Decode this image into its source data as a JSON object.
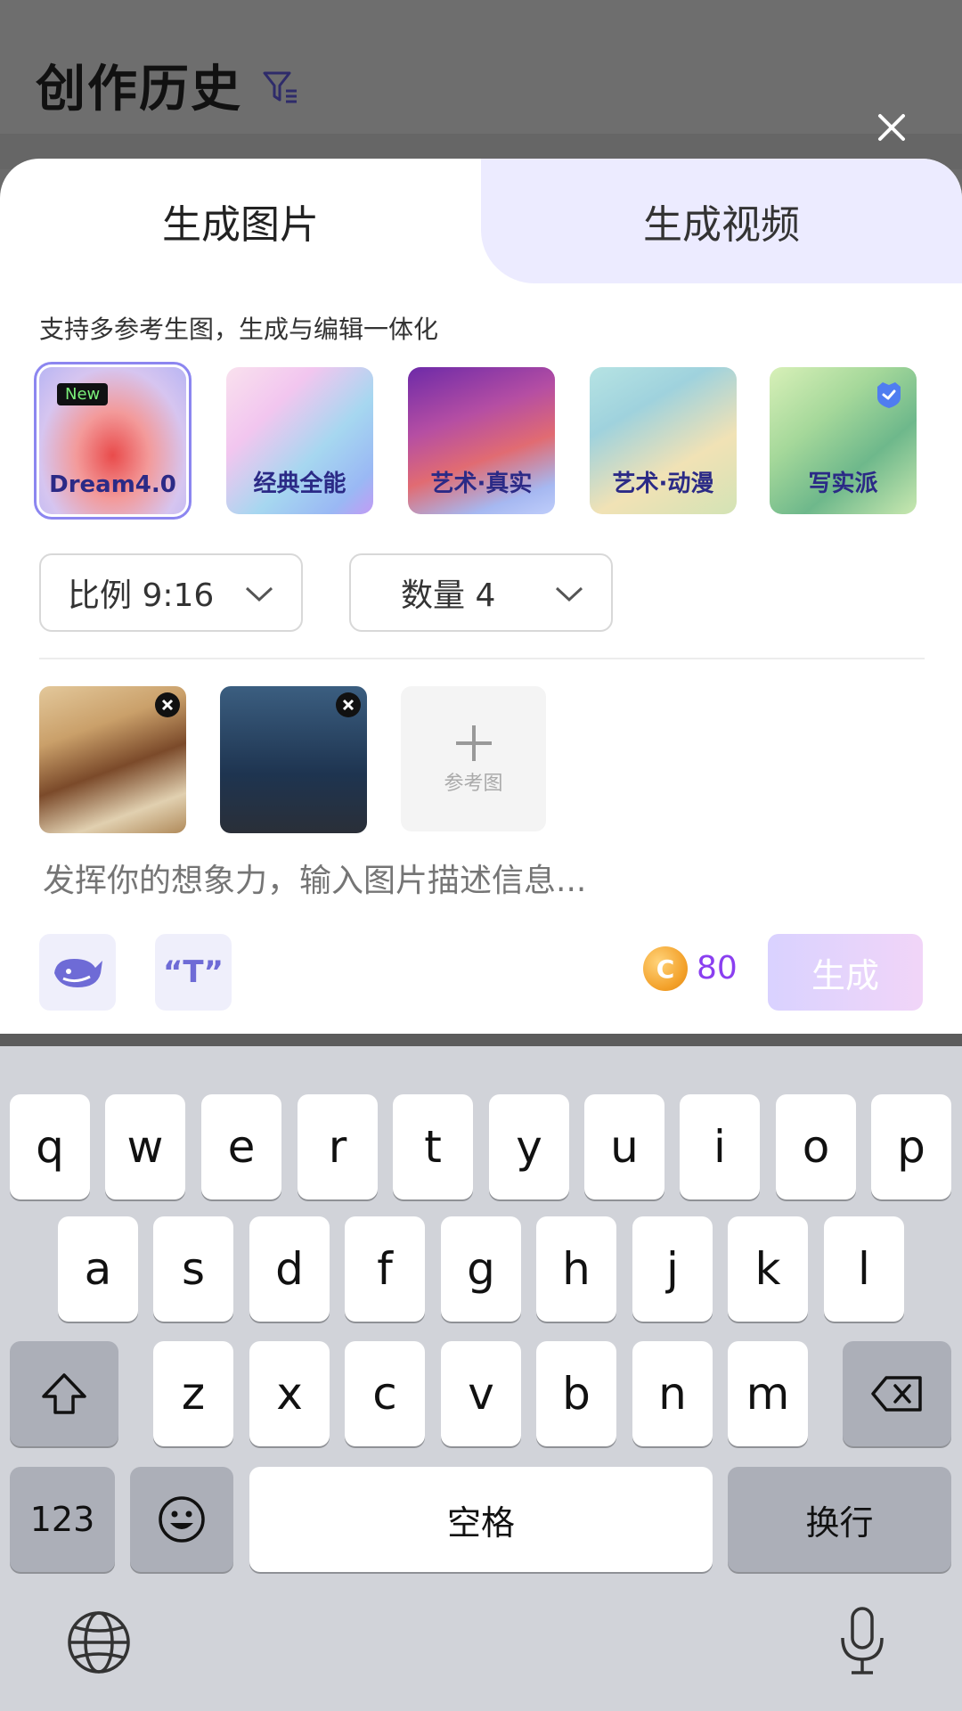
{
  "background": {
    "title": "创作历史"
  },
  "tabs": [
    {
      "label": "生成图片"
    },
    {
      "label": "生成视频"
    }
  ],
  "subtitle": "支持多参考生图，生成与编辑一体化",
  "models": [
    {
      "label": "Dream4.0",
      "badge": "New",
      "selected": true
    },
    {
      "label": "经典全能"
    },
    {
      "label": "艺术·真实"
    },
    {
      "label": "艺术·动漫"
    },
    {
      "label": "写实派",
      "badge_icon": "vip-shield-icon"
    }
  ],
  "options": {
    "ratio": "比例 9:16",
    "count": "数量 4"
  },
  "reference": {
    "add_label": "参考图"
  },
  "prompt": {
    "placeholder": "发挥你的想象力，输入图片描述信息..."
  },
  "credits": {
    "coin_symbol": "C",
    "amount": "80"
  },
  "generate_label": "生成",
  "keyboard": {
    "row1": [
      "q",
      "w",
      "e",
      "r",
      "t",
      "y",
      "u",
      "i",
      "o",
      "p"
    ],
    "row2": [
      "a",
      "s",
      "d",
      "f",
      "g",
      "h",
      "j",
      "k",
      "l"
    ],
    "row3": [
      "z",
      "x",
      "c",
      "v",
      "b",
      "n",
      "m"
    ],
    "numbers": "123",
    "space": "空格",
    "return": "换行"
  }
}
